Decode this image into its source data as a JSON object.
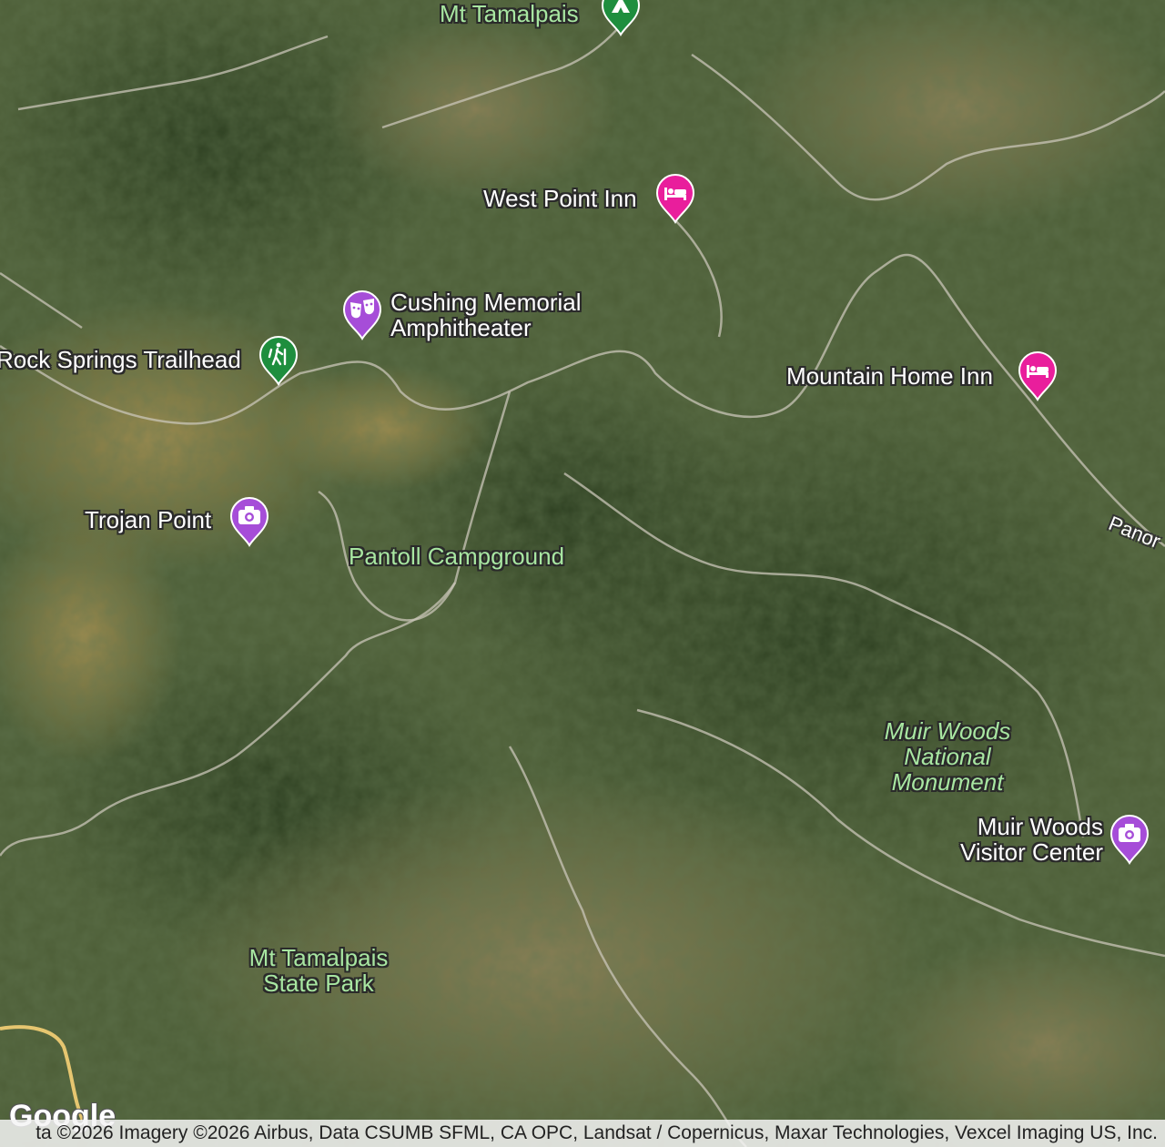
{
  "map": {
    "places": [
      {
        "id": "mt-tamalpais",
        "label": [
          "Mt Tamalpais"
        ],
        "style": "green",
        "icon": "campground-icon",
        "color": "#1e8e3e"
      },
      {
        "id": "west-point-inn",
        "label": [
          "West Point Inn"
        ],
        "style": "white",
        "icon": "bed-icon",
        "color": "#e91e9c"
      },
      {
        "id": "cushing-memorial-amphitheater",
        "label": [
          "Cushing Memorial",
          "Amphitheater"
        ],
        "style": "white",
        "icon": "theater-masks-icon",
        "color": "#a64dd8"
      },
      {
        "id": "rock-springs-trailhead",
        "label": [
          "Rock Springs Trailhead"
        ],
        "style": "white",
        "icon": "hiker-icon",
        "color": "#1e8e3e"
      },
      {
        "id": "mountain-home-inn",
        "label": [
          "Mountain Home Inn"
        ],
        "style": "white",
        "icon": "bed-icon",
        "color": "#e91e9c"
      },
      {
        "id": "trojan-point",
        "label": [
          "Trojan Point"
        ],
        "style": "white",
        "icon": "camera-icon",
        "color": "#a64dd8"
      },
      {
        "id": "pantoll-campground",
        "label": [
          "Pantoll Campground"
        ],
        "style": "green",
        "icon": "",
        "color": ""
      },
      {
        "id": "muir-woods-national-monument",
        "label": [
          "Muir Woods",
          "National",
          "Monument"
        ],
        "style": "green-italic",
        "icon": "",
        "color": ""
      },
      {
        "id": "muir-woods-visitor-center",
        "label": [
          "Muir Woods",
          "Visitor Center"
        ],
        "style": "white",
        "icon": "camera-icon",
        "color": "#a64dd8"
      },
      {
        "id": "mt-tamalpais-state-park",
        "label": [
          "Mt Tamalpais",
          "State Park"
        ],
        "style": "green",
        "icon": "",
        "color": ""
      }
    ],
    "road_label": "Panor",
    "logo": "Google",
    "attribution": "ta ©2026 Imagery ©2026 Airbus, Data CSUMB SFML, CA OPC, Landsat / Copernicus, Maxar Technologies, Vexcel Imaging US, Inc."
  }
}
